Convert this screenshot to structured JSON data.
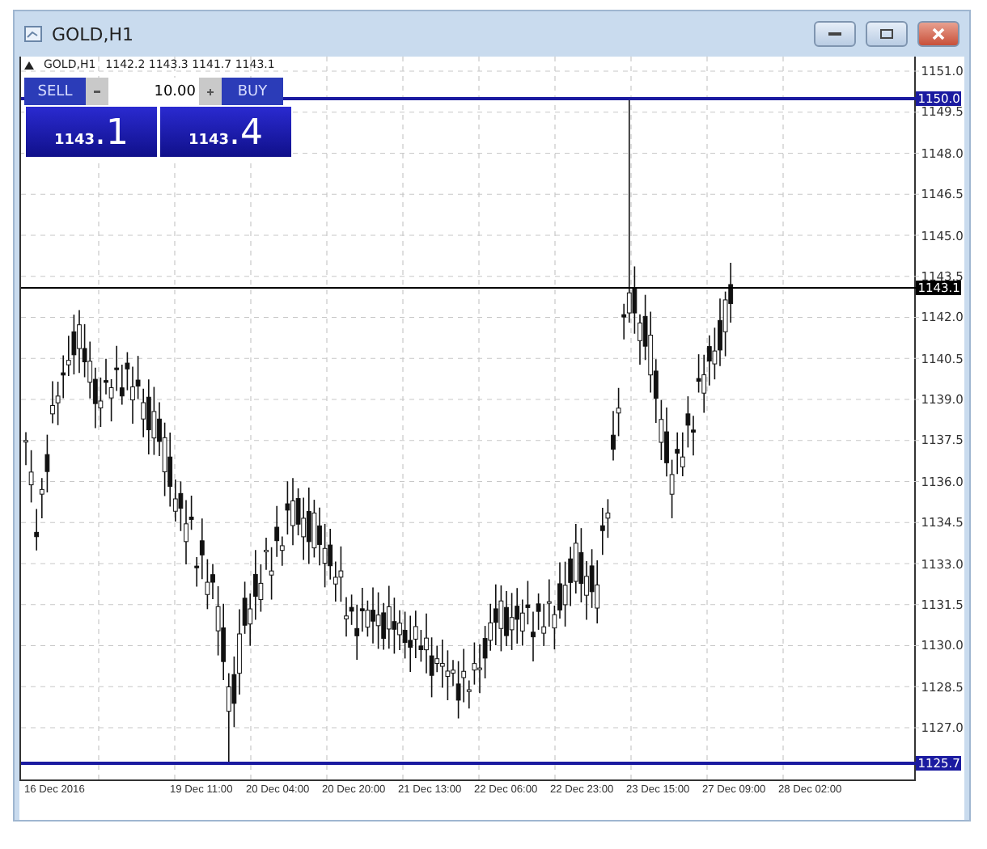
{
  "window": {
    "title": "GOLD,H1"
  },
  "chart_header": {
    "symbol": "GOLD,H1",
    "ohlc": "1142.2 1143.3 1141.7 1143.1"
  },
  "trade_panel": {
    "sell_label": "SELL",
    "buy_label": "BUY",
    "volume": "10.00",
    "sell_price_main": "1143",
    "sell_price_tail": ".1",
    "buy_price_main": "1143",
    "buy_price_tail": ".4"
  },
  "price_axis": [
    "1151.0",
    "1149.5",
    "1148.0",
    "1146.5",
    "1145.0",
    "1143.5",
    "1142.0",
    "1140.5",
    "1139.0",
    "1137.5",
    "1136.0",
    "1134.5",
    "1133.0",
    "1131.5",
    "1130.0",
    "1128.5",
    "1127.0"
  ],
  "price_lines": [
    {
      "label": "1150.0",
      "kind": "level",
      "color": "#1a1aa0"
    },
    {
      "label": "1143.1",
      "kind": "bid",
      "color": "#000000"
    },
    {
      "label": "1125.7",
      "kind": "level",
      "color": "#1a1aa0"
    }
  ],
  "time_axis": [
    "16 Dec 2016",
    "19 Dec 11:00",
    "20 Dec 04:00",
    "20 Dec 20:00",
    "21 Dec 13:00",
    "22 Dec 06:00",
    "22 Dec 23:00",
    "23 Dec 15:00",
    "27 Dec 09:00",
    "28 Dec 02:00"
  ]
}
